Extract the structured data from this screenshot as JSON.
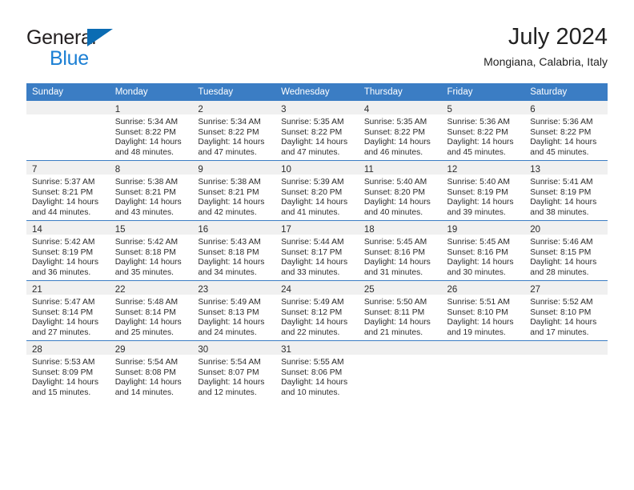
{
  "brand": {
    "line1": "General",
    "line2": "Blue",
    "triangle_color": "#0b6cb3",
    "blue_text_color": "#1b7fd4"
  },
  "header": {
    "title": "July 2024",
    "subtitle": "Mongiana, Calabria, Italy"
  },
  "theme": {
    "header_blue": "#3b7dc4",
    "daynum_band": "#f0f0f0",
    "text": "#2b2b2b"
  },
  "weekday_headers": [
    "Sunday",
    "Monday",
    "Tuesday",
    "Wednesday",
    "Thursday",
    "Friday",
    "Saturday"
  ],
  "weeks": [
    [
      {
        "day": "",
        "sunrise": "",
        "sunset": "",
        "daylight_line1": "",
        "daylight_line2": "",
        "empty": true
      },
      {
        "day": "1",
        "sunrise": "Sunrise: 5:34 AM",
        "sunset": "Sunset: 8:22 PM",
        "daylight_line1": "Daylight: 14 hours",
        "daylight_line2": "and 48 minutes."
      },
      {
        "day": "2",
        "sunrise": "Sunrise: 5:34 AM",
        "sunset": "Sunset: 8:22 PM",
        "daylight_line1": "Daylight: 14 hours",
        "daylight_line2": "and 47 minutes."
      },
      {
        "day": "3",
        "sunrise": "Sunrise: 5:35 AM",
        "sunset": "Sunset: 8:22 PM",
        "daylight_line1": "Daylight: 14 hours",
        "daylight_line2": "and 47 minutes."
      },
      {
        "day": "4",
        "sunrise": "Sunrise: 5:35 AM",
        "sunset": "Sunset: 8:22 PM",
        "daylight_line1": "Daylight: 14 hours",
        "daylight_line2": "and 46 minutes."
      },
      {
        "day": "5",
        "sunrise": "Sunrise: 5:36 AM",
        "sunset": "Sunset: 8:22 PM",
        "daylight_line1": "Daylight: 14 hours",
        "daylight_line2": "and 45 minutes."
      },
      {
        "day": "6",
        "sunrise": "Sunrise: 5:36 AM",
        "sunset": "Sunset: 8:22 PM",
        "daylight_line1": "Daylight: 14 hours",
        "daylight_line2": "and 45 minutes."
      }
    ],
    [
      {
        "day": "7",
        "sunrise": "Sunrise: 5:37 AM",
        "sunset": "Sunset: 8:21 PM",
        "daylight_line1": "Daylight: 14 hours",
        "daylight_line2": "and 44 minutes."
      },
      {
        "day": "8",
        "sunrise": "Sunrise: 5:38 AM",
        "sunset": "Sunset: 8:21 PM",
        "daylight_line1": "Daylight: 14 hours",
        "daylight_line2": "and 43 minutes."
      },
      {
        "day": "9",
        "sunrise": "Sunrise: 5:38 AM",
        "sunset": "Sunset: 8:21 PM",
        "daylight_line1": "Daylight: 14 hours",
        "daylight_line2": "and 42 minutes."
      },
      {
        "day": "10",
        "sunrise": "Sunrise: 5:39 AM",
        "sunset": "Sunset: 8:20 PM",
        "daylight_line1": "Daylight: 14 hours",
        "daylight_line2": "and 41 minutes."
      },
      {
        "day": "11",
        "sunrise": "Sunrise: 5:40 AM",
        "sunset": "Sunset: 8:20 PM",
        "daylight_line1": "Daylight: 14 hours",
        "daylight_line2": "and 40 minutes."
      },
      {
        "day": "12",
        "sunrise": "Sunrise: 5:40 AM",
        "sunset": "Sunset: 8:19 PM",
        "daylight_line1": "Daylight: 14 hours",
        "daylight_line2": "and 39 minutes."
      },
      {
        "day": "13",
        "sunrise": "Sunrise: 5:41 AM",
        "sunset": "Sunset: 8:19 PM",
        "daylight_line1": "Daylight: 14 hours",
        "daylight_line2": "and 38 minutes."
      }
    ],
    [
      {
        "day": "14",
        "sunrise": "Sunrise: 5:42 AM",
        "sunset": "Sunset: 8:19 PM",
        "daylight_line1": "Daylight: 14 hours",
        "daylight_line2": "and 36 minutes."
      },
      {
        "day": "15",
        "sunrise": "Sunrise: 5:42 AM",
        "sunset": "Sunset: 8:18 PM",
        "daylight_line1": "Daylight: 14 hours",
        "daylight_line2": "and 35 minutes."
      },
      {
        "day": "16",
        "sunrise": "Sunrise: 5:43 AM",
        "sunset": "Sunset: 8:18 PM",
        "daylight_line1": "Daylight: 14 hours",
        "daylight_line2": "and 34 minutes."
      },
      {
        "day": "17",
        "sunrise": "Sunrise: 5:44 AM",
        "sunset": "Sunset: 8:17 PM",
        "daylight_line1": "Daylight: 14 hours",
        "daylight_line2": "and 33 minutes."
      },
      {
        "day": "18",
        "sunrise": "Sunrise: 5:45 AM",
        "sunset": "Sunset: 8:16 PM",
        "daylight_line1": "Daylight: 14 hours",
        "daylight_line2": "and 31 minutes."
      },
      {
        "day": "19",
        "sunrise": "Sunrise: 5:45 AM",
        "sunset": "Sunset: 8:16 PM",
        "daylight_line1": "Daylight: 14 hours",
        "daylight_line2": "and 30 minutes."
      },
      {
        "day": "20",
        "sunrise": "Sunrise: 5:46 AM",
        "sunset": "Sunset: 8:15 PM",
        "daylight_line1": "Daylight: 14 hours",
        "daylight_line2": "and 28 minutes."
      }
    ],
    [
      {
        "day": "21",
        "sunrise": "Sunrise: 5:47 AM",
        "sunset": "Sunset: 8:14 PM",
        "daylight_line1": "Daylight: 14 hours",
        "daylight_line2": "and 27 minutes."
      },
      {
        "day": "22",
        "sunrise": "Sunrise: 5:48 AM",
        "sunset": "Sunset: 8:14 PM",
        "daylight_line1": "Daylight: 14 hours",
        "daylight_line2": "and 25 minutes."
      },
      {
        "day": "23",
        "sunrise": "Sunrise: 5:49 AM",
        "sunset": "Sunset: 8:13 PM",
        "daylight_line1": "Daylight: 14 hours",
        "daylight_line2": "and 24 minutes."
      },
      {
        "day": "24",
        "sunrise": "Sunrise: 5:49 AM",
        "sunset": "Sunset: 8:12 PM",
        "daylight_line1": "Daylight: 14 hours",
        "daylight_line2": "and 22 minutes."
      },
      {
        "day": "25",
        "sunrise": "Sunrise: 5:50 AM",
        "sunset": "Sunset: 8:11 PM",
        "daylight_line1": "Daylight: 14 hours",
        "daylight_line2": "and 21 minutes."
      },
      {
        "day": "26",
        "sunrise": "Sunrise: 5:51 AM",
        "sunset": "Sunset: 8:10 PM",
        "daylight_line1": "Daylight: 14 hours",
        "daylight_line2": "and 19 minutes."
      },
      {
        "day": "27",
        "sunrise": "Sunrise: 5:52 AM",
        "sunset": "Sunset: 8:10 PM",
        "daylight_line1": "Daylight: 14 hours",
        "daylight_line2": "and 17 minutes."
      }
    ],
    [
      {
        "day": "28",
        "sunrise": "Sunrise: 5:53 AM",
        "sunset": "Sunset: 8:09 PM",
        "daylight_line1": "Daylight: 14 hours",
        "daylight_line2": "and 15 minutes."
      },
      {
        "day": "29",
        "sunrise": "Sunrise: 5:54 AM",
        "sunset": "Sunset: 8:08 PM",
        "daylight_line1": "Daylight: 14 hours",
        "daylight_line2": "and 14 minutes."
      },
      {
        "day": "30",
        "sunrise": "Sunrise: 5:54 AM",
        "sunset": "Sunset: 8:07 PM",
        "daylight_line1": "Daylight: 14 hours",
        "daylight_line2": "and 12 minutes."
      },
      {
        "day": "31",
        "sunrise": "Sunrise: 5:55 AM",
        "sunset": "Sunset: 8:06 PM",
        "daylight_line1": "Daylight: 14 hours",
        "daylight_line2": "and 10 minutes."
      },
      {
        "day": "",
        "sunrise": "",
        "sunset": "",
        "daylight_line1": "",
        "daylight_line2": "",
        "empty": true
      },
      {
        "day": "",
        "sunrise": "",
        "sunset": "",
        "daylight_line1": "",
        "daylight_line2": "",
        "empty": true
      },
      {
        "day": "",
        "sunrise": "",
        "sunset": "",
        "daylight_line1": "",
        "daylight_line2": "",
        "empty": true
      }
    ]
  ]
}
